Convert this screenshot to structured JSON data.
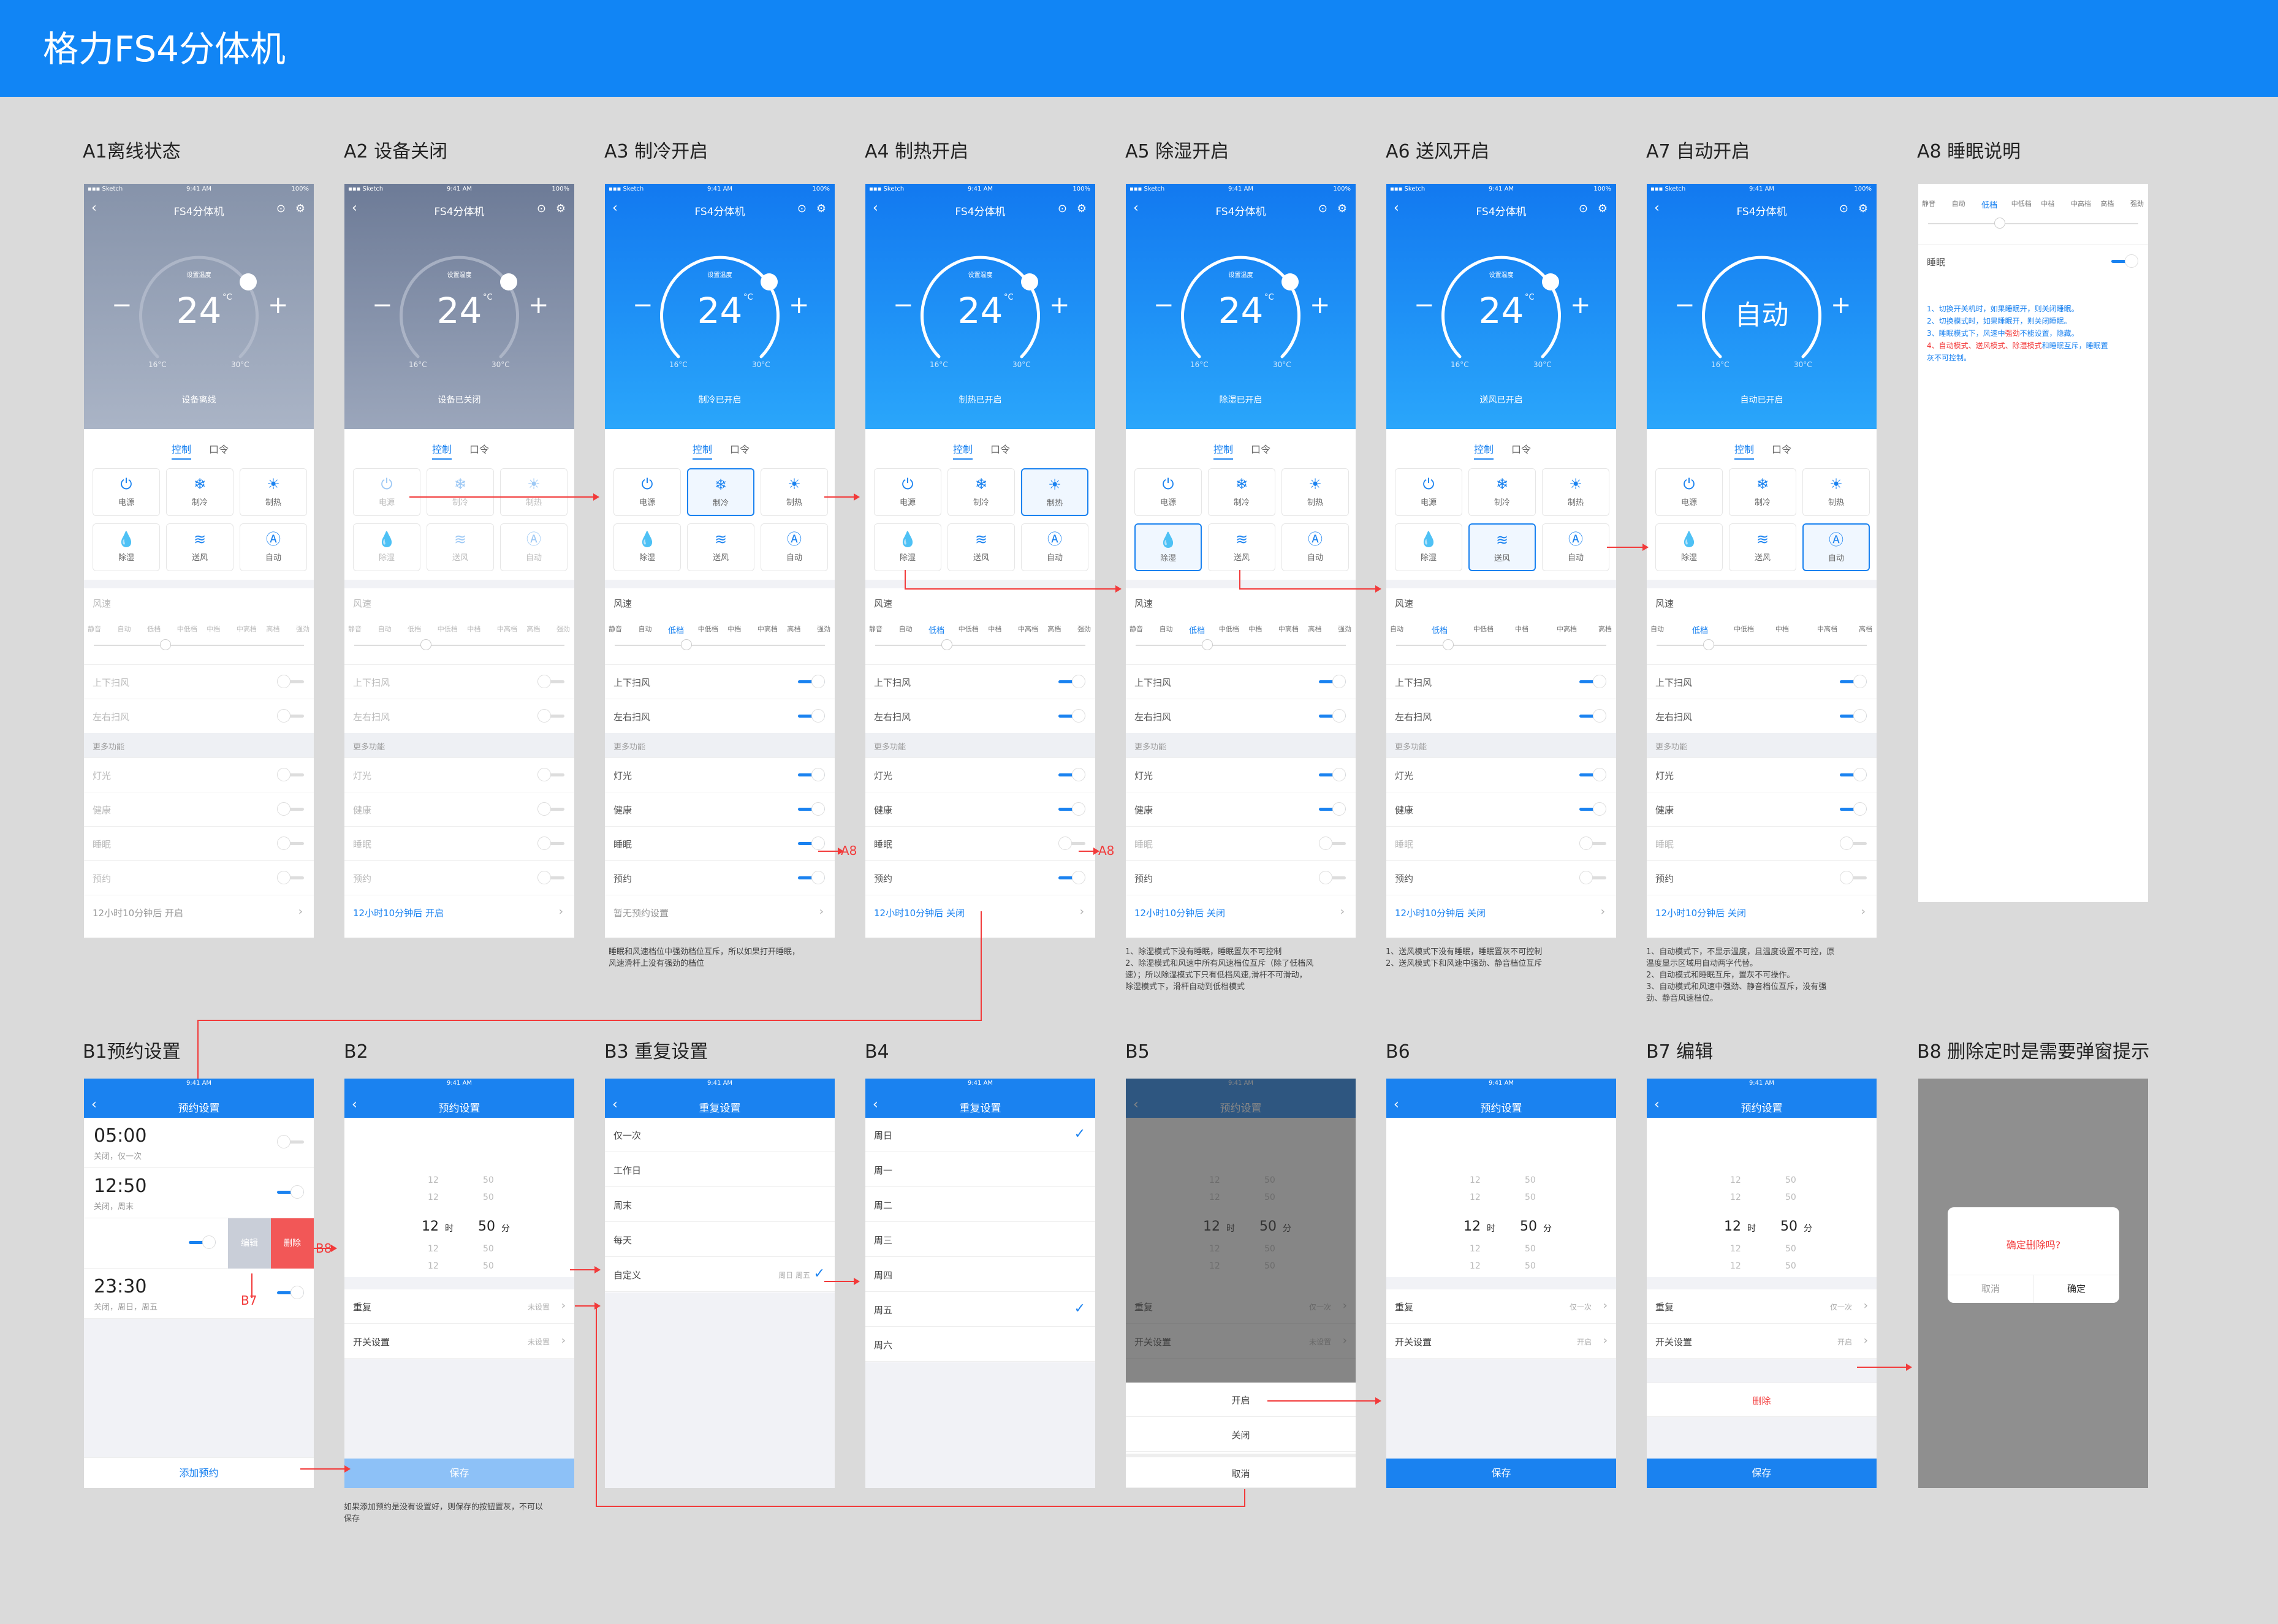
{
  "title": "格力FS4分体机",
  "labels": {
    "a1": "A1离线状态",
    "a2": "A2 设备关闭",
    "a3": "A3 制冷开启",
    "a4": "A4 制热开启",
    "a5": "A5 除湿开启",
    "a6": "A6 送风开启",
    "a7": "A7 自动开启",
    "a8": "A8 睡眠说明",
    "b1": "B1预约设置",
    "b2": "B2",
    "b3": "B3 重复设置",
    "b4": "B4",
    "b5": "B5",
    "b6": "B6",
    "b7": "B7 编辑",
    "b8": "B8 删除定时是需要弹窗提示"
  },
  "status": {
    "carrier": "▪▪▪ Sketch",
    "time": "9:41 AM",
    "battery": "100%"
  },
  "device": {
    "name": "FS4分体机",
    "back": "‹",
    "more": "⊙",
    "gear": "⚙",
    "minus": "−",
    "plus": "+",
    "setTemp": "设置温度",
    "temp": "24",
    "unit": "°C",
    "auto": "自动",
    "low": "16°C",
    "high": "30°C"
  },
  "states": {
    "a1": "设备离线",
    "a2": "设备已关闭",
    "a3": "制冷已开启",
    "a4": "制热已开启",
    "a5": "除湿已开启",
    "a6": "送风已开启",
    "a7": "自动已开启"
  },
  "tabs": {
    "control": "控制",
    "voice": "口令"
  },
  "controls": {
    "power": "电源",
    "cool": "制冷",
    "heat": "制热",
    "dry": "除湿",
    "fan": "送风",
    "auto": "自动"
  },
  "icons": {
    "power": "⏻",
    "cool": "❄",
    "heat": "☀",
    "dry": "💧",
    "fan": "≋",
    "auto": "Ⓐ"
  },
  "fan": {
    "title": "风速",
    "speeds8": [
      "静音",
      "自动",
      "低档",
      "中低档",
      "中档",
      "中高档",
      "高档",
      "强劲"
    ],
    "speeds6": [
      "自动",
      "低档",
      "中低档",
      "中档",
      "中高档",
      "高档"
    ]
  },
  "rows": {
    "updown": "上下扫风",
    "leftright": "左右扫风",
    "more": "更多功能",
    "light": "灯光",
    "health": "健康",
    "sleep": "睡眠",
    "reserve": "预约"
  },
  "footers": {
    "a1": "12小时10分钟后 开启",
    "a2": "12小时10分钟后 开启",
    "a3": "暂无预约设置",
    "a4": "12小时10分钟后 关闭",
    "a5": "12小时10分钟后 关闭",
    "a6": "12小时10分钟后 关闭",
    "a7": "12小时10分钟后 关闭"
  },
  "notes": {
    "a3": [
      "睡眠和风速档位中强劲档位互斥，所以如果打开睡眠，",
      "风速滑杆上没有强劲的档位"
    ],
    "a5": [
      "1、除湿模式下没有睡眠，睡眠置灰不可控制",
      "2、除湿模式和风速中所有风速档位互斥（除了低档风",
      "速）；所以除湿模式下只有低档风速,滑杆不可滑动，",
      "除湿模式下，滑杆自动到低档模式"
    ],
    "a6": [
      "1、送风模式下没有睡眠，睡眠置灰不可控制",
      "2、送风模式下和风速中强劲、静音档位互斥"
    ],
    "a7": [
      "1、自动模式下，不显示温度，且温度设置不可控，原",
      "温度显示区域用自动两字代替。",
      "2、自动模式和睡眠互斥，置灰不可操作。",
      "3、自动模式和风速中强劲、静音档位互斥，没有强",
      "劲、静音风速档位。"
    ],
    "a8": {
      "l1": "1、切换开关机时，如果睡眠开，则关闭睡眠。",
      "l2": "2、切换模式时，如果睡眠开，则关闭睡眠。",
      "l3a": "3、睡眠模式下，风速中",
      "l3b": "强劲",
      "l3c": "不能设置，隐藏。",
      "l4a": "4、自动模式、送风模式、除湿模式",
      "l4b": "和睡眠互斥，睡眠置",
      "l5": "灰不可控制。"
    },
    "b2": [
      "如果添加预约是没有设置好，则保存的按钮置灰，不可以",
      "保存"
    ]
  },
  "a8": {
    "sleep": "睡眠"
  },
  "booking": {
    "title": "预约设置",
    "add": "添加预约",
    "alarms": [
      {
        "time": "05:00",
        "rep": "关闭，仅一次"
      },
      {
        "time": "12:50",
        "rep": "关闭，周末"
      },
      {
        "time": "23:30",
        "rep": "关闭，周日，周五"
      }
    ],
    "edit": "编辑",
    "del": "删除"
  },
  "picker": {
    "hrs": [
      "12",
      "12",
      "12",
      "12",
      "12"
    ],
    "mins": [
      "50",
      "50",
      "50",
      "50",
      "50"
    ],
    "h": "时",
    "m": "分"
  },
  "setting": {
    "repeat": "重复",
    "switch": "开关设置",
    "notset": "未设置",
    "once": "仅一次",
    "open": "开启",
    "save": "保存",
    "delete": "删除"
  },
  "repeatSet": {
    "title": "重复设置",
    "opts": [
      "仅一次",
      "工作日",
      "周末",
      "每天",
      "自定义"
    ],
    "custom": "周日  周五",
    "check": "✓"
  },
  "week": [
    "周日",
    "周一",
    "周二",
    "周三",
    "周四",
    "周五",
    "周六"
  ],
  "sheet": {
    "open": "开启",
    "close": "关闭",
    "cancel": "取消"
  },
  "dialog": {
    "msg": "确定删除吗?",
    "cancel": "取消",
    "ok": "确定"
  },
  "anno": {
    "a8": "A8",
    "b8": "B8",
    "b7": "B7"
  }
}
